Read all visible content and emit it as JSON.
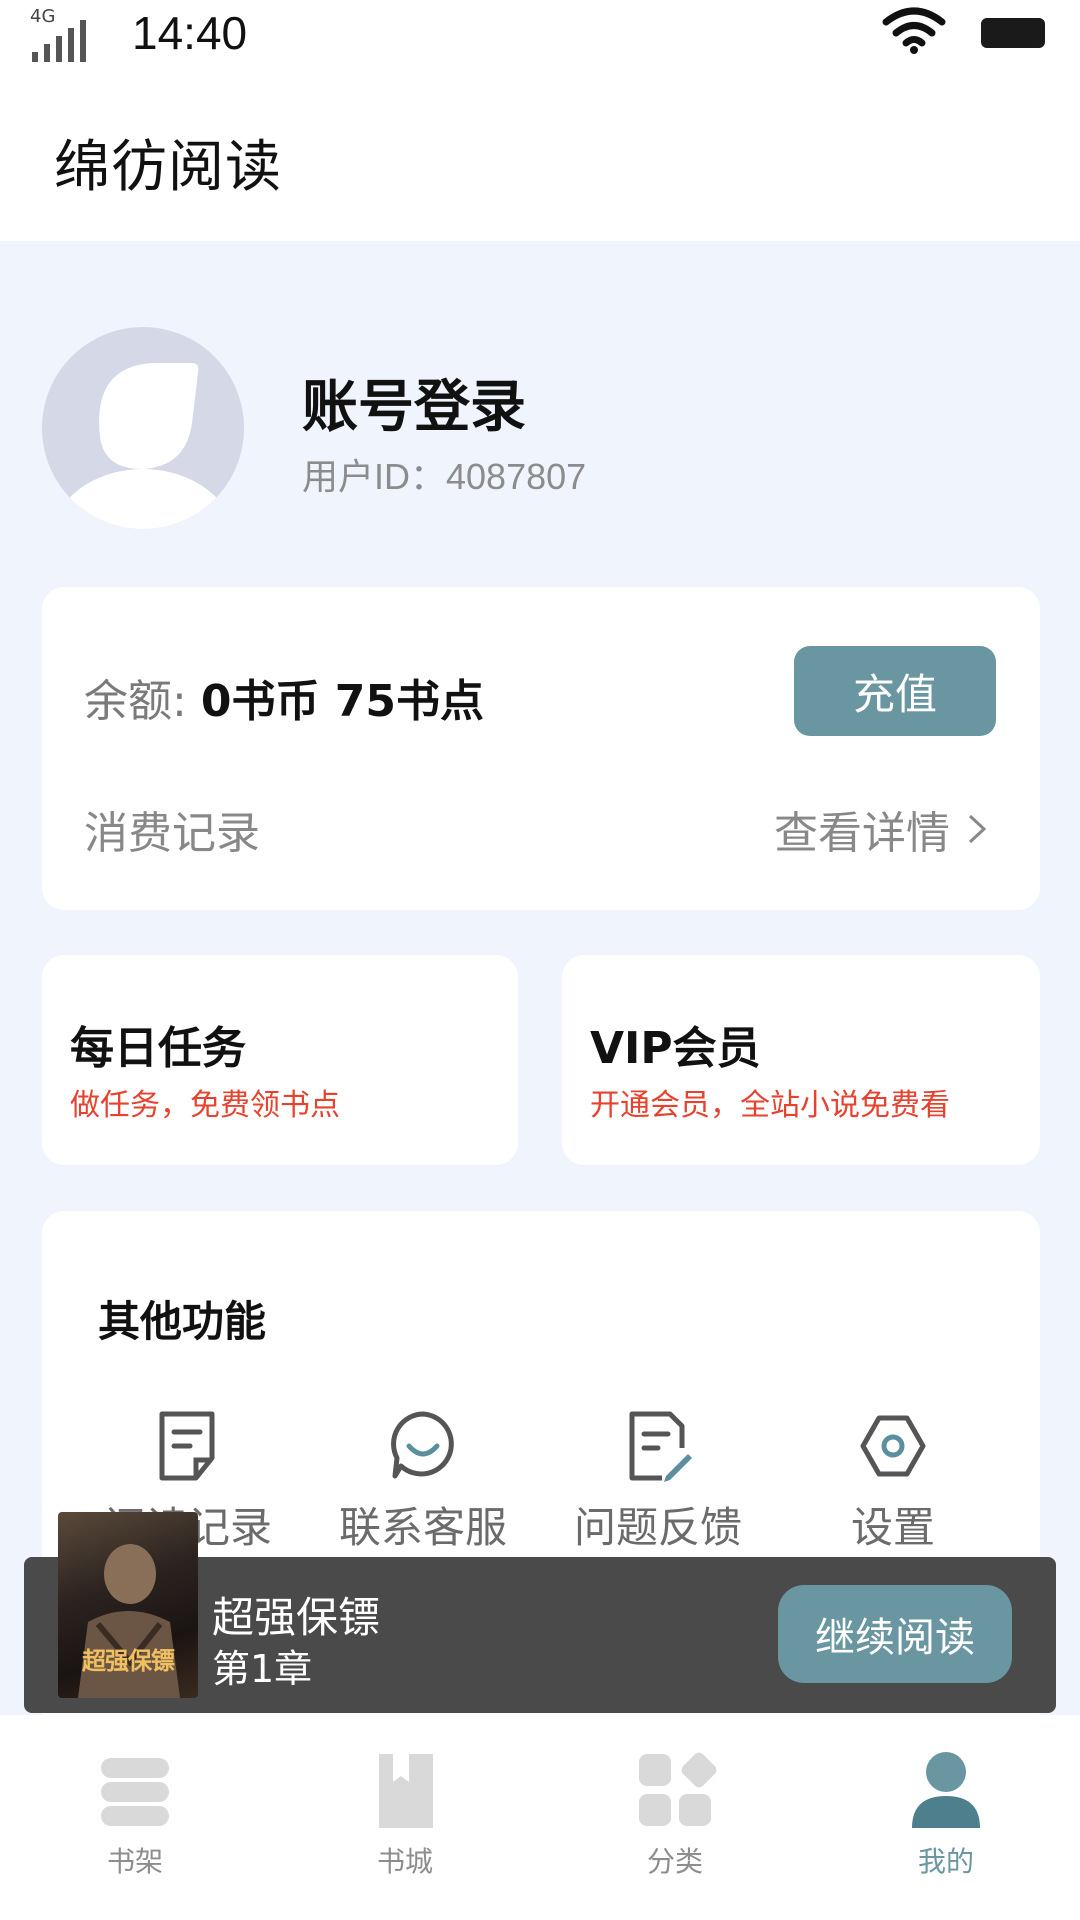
{
  "status_bar": {
    "network": "4G",
    "time": "14:40",
    "icons": [
      "signal-icon",
      "wifi-icon",
      "battery-icon"
    ]
  },
  "app": {
    "title": "绵彷阅读"
  },
  "profile": {
    "account_label": "账号登录",
    "user_id": "用户ID：4087807",
    "avatar_icon": "avatar-placeholder-icon"
  },
  "balance": {
    "label": "余额:",
    "value": "0书币 75书点",
    "recharge_label": "充值",
    "records_label": "消费记录",
    "details_label": "查看详情",
    "details_icon": "chevron-right-icon"
  },
  "tasks": {
    "daily_title": "每日任务",
    "daily_sub": "做任务，免费领书点",
    "vip_title": "VIP会员",
    "vip_sub": "开通会员，全站小说免费看"
  },
  "features": {
    "title": "其他功能",
    "items": [
      {
        "label": "阅读记录",
        "icon": "document-icon"
      },
      {
        "label": "联系客服",
        "icon": "chat-icon"
      },
      {
        "label": "问题反馈",
        "icon": "feedback-icon"
      },
      {
        "label": "设置",
        "icon": "settings-icon"
      }
    ]
  },
  "reading": {
    "book_title": "超强保镖",
    "chapter": "第1章",
    "continue_label": "继续阅读",
    "cover_title": "超强保镖"
  },
  "tabs": [
    {
      "label": "书架",
      "icon": "bookshelf-icon",
      "active": false
    },
    {
      "label": "书城",
      "icon": "bookstore-icon",
      "active": false
    },
    {
      "label": "分类",
      "icon": "category-icon",
      "active": false
    },
    {
      "label": "我的",
      "icon": "profile-icon",
      "active": true
    }
  ],
  "colors": {
    "accent": "#6a96a2",
    "page_background": "#f0f4fd",
    "highlight_text": "#e8422f",
    "reading_bar": "#4a4a4a"
  }
}
